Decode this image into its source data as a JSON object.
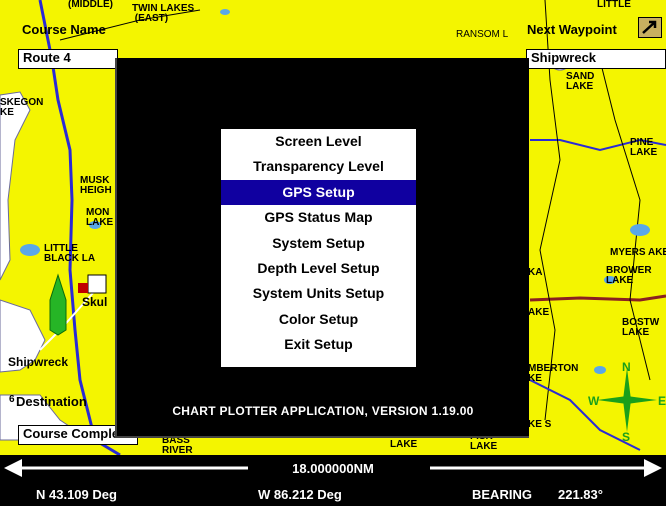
{
  "map": {
    "labels": {
      "twin_lakes": "TWIN LAKES\n (EAST)",
      "middle": "(MIDDLE)",
      "ransom": "RANSOM L",
      "lite": "LITTLE",
      "sand_lake": "SAND\nLAKE",
      "muskegon": "SKEGON\nKE",
      "musk_height": "MUSK\nHEIGH",
      "mon_lake": "MON\nLAKE",
      "little_black": "LITTLE\nBLACK LA",
      "skull": "Skul",
      "shipwreck": "Shipwreck",
      "pine_lake": "PINE\nLAKE",
      "myers_lake": "MYERS AKE",
      "brower_lake": "BROWER\nLAKE",
      "kake": "KA",
      "ake": "AKE",
      "bostwick": "BOSTW\nLAKE",
      "pemberton": "MBERTON\nKE",
      "lake": "LAKE",
      "fisk_lake": "FISK\nLAKE",
      "bass_river": "BASS\nRIVER",
      "lake_s": "KE S"
    },
    "compass": {
      "n": "N",
      "s": "S",
      "w": "W",
      "e": "E"
    }
  },
  "panel": {
    "course_name_label": "Course Name",
    "course_name_value": "Route 4",
    "next_waypoint_label": "Next Waypoint",
    "next_waypoint_value": "Shipwreck",
    "destination_label": "Destination",
    "destination_prefix": "6",
    "course_complete_value": "Course Complete"
  },
  "dialog": {
    "menu": [
      {
        "label": "Screen Level"
      },
      {
        "label": "Transparency Level"
      },
      {
        "label": "GPS Setup",
        "selected": true
      },
      {
        "label": "GPS Status Map"
      },
      {
        "label": "System Setup"
      },
      {
        "label": "Depth Level Setup"
      },
      {
        "label": "System Units Setup"
      },
      {
        "label": "Color Setup"
      },
      {
        "label": "Exit Setup"
      }
    ],
    "version": "CHART PLOTTER APPLICATION, VERSION 1.19.00"
  },
  "scale": {
    "distance": "18.000000NM"
  },
  "status": {
    "lat": "N  43.109 Deg",
    "lon": "W  86.212 Deg",
    "bearing_label": "BEARING",
    "bearing_value": "221.83°"
  },
  "colors": {
    "land": "#f4f500",
    "water": "#5aa7e8",
    "road": "#2a2ad6",
    "menu_highlight": "#1000a0"
  }
}
